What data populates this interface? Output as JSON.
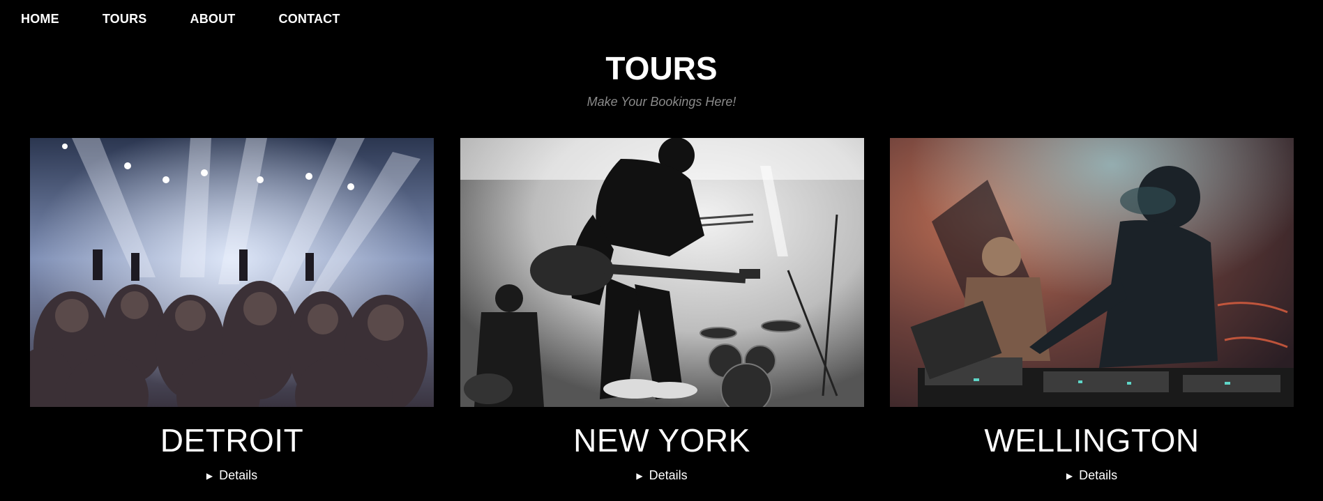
{
  "nav": {
    "items": [
      {
        "label": "HOME"
      },
      {
        "label": "TOURS"
      },
      {
        "label": "ABOUT"
      },
      {
        "label": "CONTACT"
      }
    ]
  },
  "header": {
    "title": "TOURS",
    "subtitle": "Make Your Bookings Here!"
  },
  "cards": [
    {
      "city": "DETROIT",
      "details_label": "Details"
    },
    {
      "city": "NEW YORK",
      "details_label": "Details"
    },
    {
      "city": "WELLINGTON",
      "details_label": "Details"
    }
  ],
  "colors": {
    "background": "#000000",
    "text": "#ffffff",
    "subtitle": "#8a8a8a"
  }
}
